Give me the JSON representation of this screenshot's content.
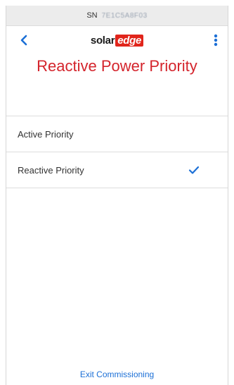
{
  "status_bar": {
    "sn_label": "SN",
    "sn_value": "7E1C5A8F03"
  },
  "header": {
    "logo_solar": "solar",
    "logo_edge": "edge"
  },
  "page": {
    "title": "Reactive Power Priority"
  },
  "options": [
    {
      "label": "Active Priority",
      "selected": false
    },
    {
      "label": "Reactive Priority",
      "selected": true
    }
  ],
  "footer": {
    "exit_label": "Exit Commissioning"
  },
  "colors": {
    "accent": "#1b6fd6",
    "title": "#d4242c",
    "brand": "#e1251b"
  },
  "icons": {
    "back": "chevron-left-icon",
    "menu": "kebab-menu-icon",
    "selected": "checkmark-icon"
  }
}
